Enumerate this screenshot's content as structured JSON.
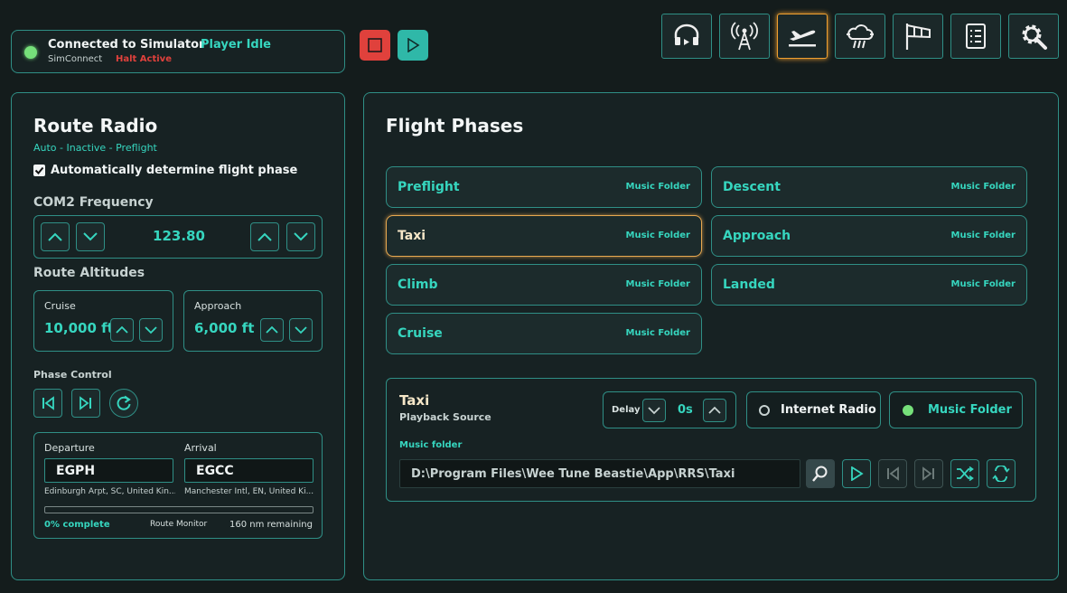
{
  "status": {
    "title": "Connected to Simulator",
    "player": "Player Idle",
    "sub": "SimConnect",
    "halt": "Halt Active"
  },
  "colors": {
    "accent": "#36d6bf",
    "border": "#2f8f86",
    "danger": "#e0413c",
    "active": "#f0a030",
    "ok": "#76e07a"
  },
  "nav": {
    "icons": [
      "headset-icon",
      "radio-tower-icon",
      "takeoff-icon",
      "weather-icon",
      "windsock-icon",
      "checklist-icon",
      "settings-icon"
    ]
  },
  "left": {
    "title": "Route Radio",
    "mode": "Auto - Inactive - Preflight",
    "auto_label": "Automatically determine flight phase",
    "com2_label": "COM2 Frequency",
    "com2_value": "123.80",
    "altitudes_label": "Route Altitudes",
    "cruise_label": "Cruise",
    "cruise_value": "10,000 ft",
    "approach_label": "Approach",
    "approach_value": "6,000 ft",
    "phase_control_label": "Phase Control",
    "departure_label": "Departure",
    "departure_code": "EGPH",
    "departure_name": "Edinburgh Arpt, SC, United Kin...",
    "arrival_label": "Arrival",
    "arrival_code": "EGCC",
    "arrival_name": "Manchester Intl, EN, United Ki...",
    "progress_text": "0% complete",
    "progress_fraction": 0,
    "route_monitor": "Route Monitor",
    "remaining": "160 nm remaining"
  },
  "right": {
    "title": "Flight Phases",
    "phases": [
      {
        "name": "Preflight",
        "source": "Music Folder"
      },
      {
        "name": "Descent",
        "source": "Music Folder"
      },
      {
        "name": "Taxi",
        "source": "Music Folder"
      },
      {
        "name": "Approach",
        "source": "Music Folder"
      },
      {
        "name": "Climb",
        "source": "Music Folder"
      },
      {
        "name": "Landed",
        "source": "Music Folder"
      },
      {
        "name": "Cruise",
        "source": "Music Folder"
      }
    ],
    "detail": {
      "phase": "Taxi",
      "playback_source": "Playback Source",
      "delay_label": "Delay",
      "delay_value": "0s",
      "internet_radio": "Internet Radio",
      "music_folder": "Music Folder",
      "folder_label": "Music folder",
      "folder_path": "D:\\Program Files\\Wee Tune Beastie\\App\\RRS\\Taxi"
    }
  }
}
